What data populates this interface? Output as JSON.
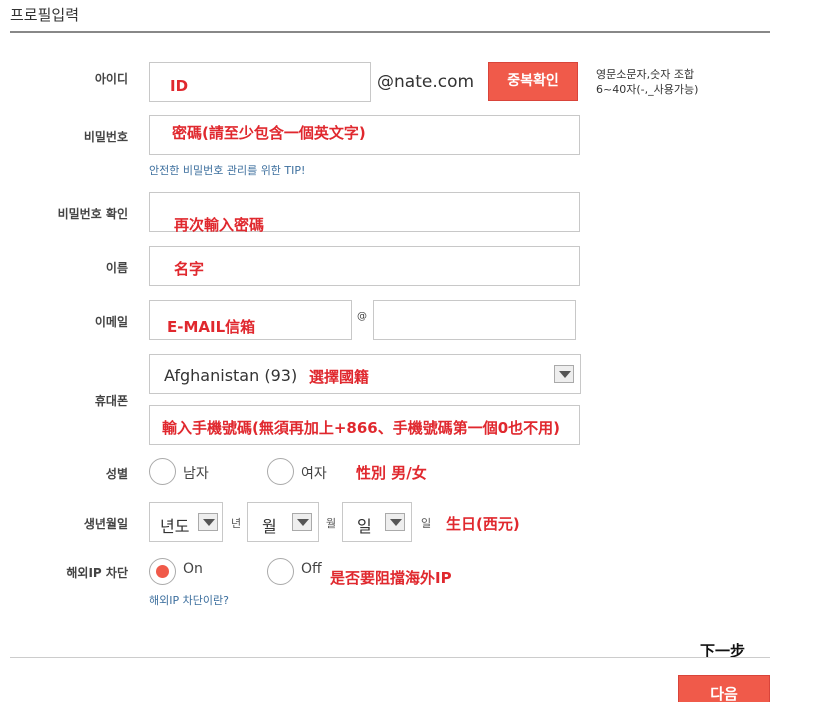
{
  "header": {
    "title": "프로필입력"
  },
  "fields": {
    "id": {
      "label": "아이디",
      "placeholder": "",
      "domain": "@nate.com",
      "annotation": "ID",
      "check_button": "중복확인",
      "hint_line1": "영문소문자,숫자 조합",
      "hint_line2": "6~40자(-,_사용가능)"
    },
    "password": {
      "label": "비밀번호",
      "annotation": "密碼(請至少包含一個英文字)",
      "tip_link": "안전한 비밀번호 관리를 위한 TIP!"
    },
    "password_confirm": {
      "label": "비밀번호 확인",
      "annotation": "再次輸入密碼"
    },
    "name": {
      "label": "이름",
      "annotation": "名字"
    },
    "email": {
      "label": "이메일",
      "annotation": "E-MAIL信箱",
      "at": "@"
    },
    "phone": {
      "label": "휴대폰",
      "country_selected": "Afghanistan (93)",
      "country_annotation": "選擇國籍",
      "number_annotation": "輸入手機號碼(無須再加上+866、手機號碼第一個0也不用)"
    },
    "gender": {
      "label": "성별",
      "male": "남자",
      "female": "여자",
      "annotation": "性別 男/女"
    },
    "birth": {
      "label": "생년월일",
      "year_selected": "년도",
      "year_unit": "년",
      "month_selected": "월",
      "month_unit": "월",
      "day_selected": "일",
      "day_unit": "일",
      "annotation": "生日(西元)"
    },
    "overseas_ip": {
      "label": "해외IP 차단",
      "on": "On",
      "off": "Off",
      "selected": "On",
      "annotation": "是否要阻擋海外IP",
      "help_link": "해외IP 차단이란?"
    }
  },
  "footer": {
    "next_annotation": "下一步",
    "next_button": "다음"
  },
  "colors": {
    "accent": "#f05a4a",
    "annotation": "#e0282e",
    "link": "#3d6f9e"
  }
}
